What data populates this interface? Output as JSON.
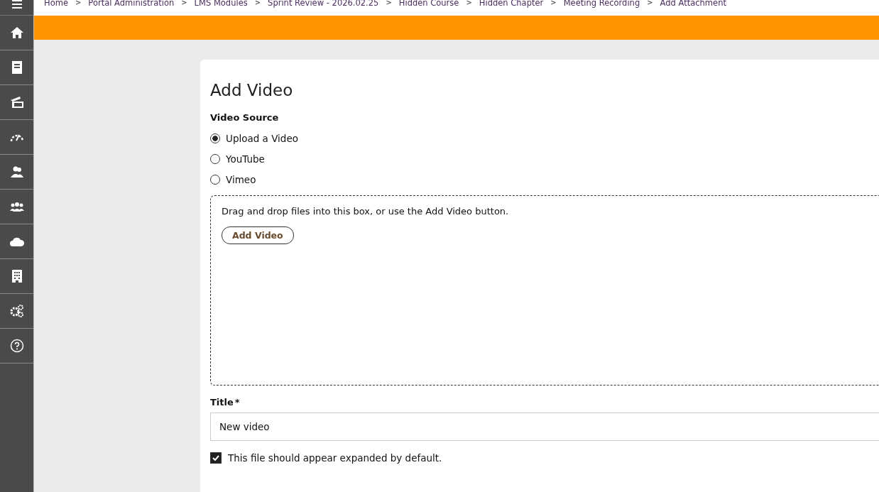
{
  "breadcrumbs": [
    "Home",
    "Portal Administration",
    "LMS Modules",
    "Sprint Review - 2026.02.25",
    "Hidden Course",
    "Hidden Chapter",
    "Meeting Recording",
    "Add Attachment"
  ],
  "breadcrumb_separator": ">",
  "sidebar": {
    "items": [
      {
        "kind": "home"
      },
      {
        "kind": "book"
      },
      {
        "kind": "media"
      },
      {
        "kind": "gauge"
      },
      {
        "kind": "user"
      },
      {
        "kind": "group"
      },
      {
        "kind": "cloud"
      },
      {
        "kind": "building"
      },
      {
        "kind": "gears"
      },
      {
        "kind": "help"
      }
    ]
  },
  "form": {
    "title": "Add Video",
    "source_label": "Video Source",
    "sources": [
      {
        "label": "Upload a Video",
        "selected": true
      },
      {
        "label": "YouTube",
        "selected": false
      },
      {
        "label": "Vimeo",
        "selected": false
      }
    ],
    "dropzone": {
      "text": "Drag and drop files into this box, or use the Add Video button.",
      "button": "Add Video"
    },
    "title_label": "Title",
    "required_mark": "*",
    "title_value": "New video",
    "expanded": {
      "label": "This file should appear expanded by default.",
      "checked": true
    }
  }
}
